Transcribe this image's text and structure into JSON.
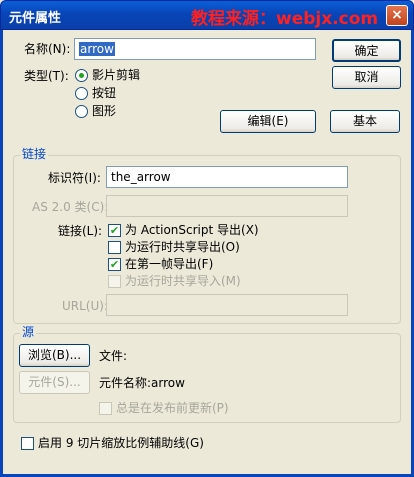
{
  "window": {
    "title": "元件属性",
    "watermark": "教程来源：webjx.com",
    "close_glyph": "×"
  },
  "props": {
    "name_label": "名称(N):",
    "name_value": "arrow",
    "type_label": "类型(T):",
    "types": [
      "影片剪辑",
      "按钮",
      "图形"
    ],
    "selected_type": "影片剪辑"
  },
  "buttons": {
    "ok": "确定",
    "cancel": "取消",
    "edit": "编辑(E)",
    "basic": "基本"
  },
  "linkage": {
    "section": "链接",
    "identifier_label": "标识符(I):",
    "identifier_value": "the_arrow",
    "class_label": "AS 2.0 类(C):",
    "class_value": "",
    "linkage_label": "链接(L):",
    "options": [
      {
        "label": "为 ActionScript 导出(X)",
        "checked": true,
        "enabled": true
      },
      {
        "label": "为运行时共享导出(O)",
        "checked": false,
        "enabled": true
      },
      {
        "label": "在第一帧导出(F)",
        "checked": true,
        "enabled": true
      },
      {
        "label": "为运行时共享导入(M)",
        "checked": false,
        "enabled": false
      }
    ],
    "url_label": "URL(U):",
    "url_value": ""
  },
  "source": {
    "section": "源",
    "browse_button": "浏览(B)...",
    "file_label": "文件:",
    "symbol_button": "元件(S)...",
    "symbol_name_text": "元件名称:arrow",
    "always_update_label": "总是在发布前更新(P)"
  },
  "footer": {
    "scale9_label": "启用 9 切片缩放比例辅助线(G)",
    "checkmark_glyph": "✔"
  }
}
